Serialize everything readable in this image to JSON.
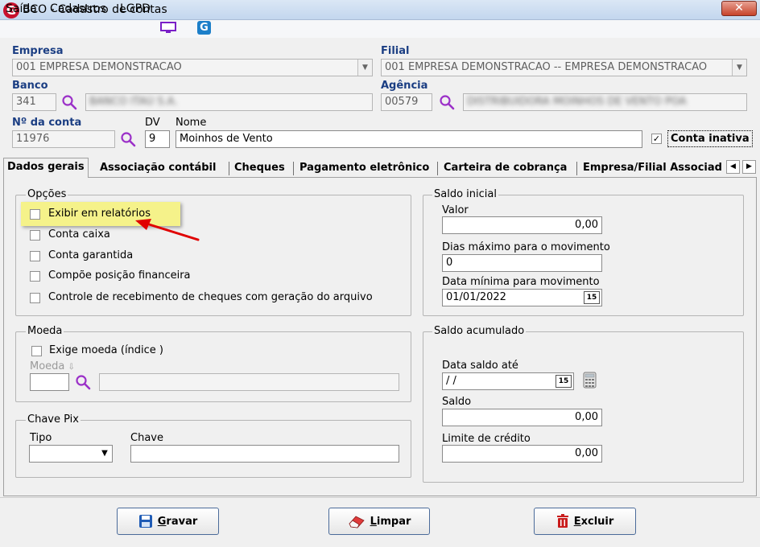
{
  "window": {
    "logo": "G",
    "title": "BCO - Cadastro de contas",
    "close": "✕"
  },
  "menu": {
    "items": [
      "Saída",
      "Cadastros",
      "LGPD"
    ],
    "g_logo": "G"
  },
  "colors": {
    "accent": "#1b3e83",
    "highlight": "#f5f28a",
    "arrow": "#e00000",
    "search": "#9b30c8"
  },
  "header": {
    "empresa_label": "Empresa",
    "empresa_value": "001 EMPRESA DEMONSTRACAO",
    "filial_label": "Filial",
    "filial_value": "001 EMPRESA DEMONSTRACAO -- EMPRESA DEMONSTRACAO",
    "banco_label": "Banco",
    "banco_code": "341",
    "banco_name": "BANCO ITAÚ S.A.",
    "agencia_label": "Agência",
    "agencia_code": "00579",
    "agencia_name": "DISTRIBUIDORA MOINHOS DE VENTO POA",
    "conta_label": "Nº da conta",
    "conta_value": "11976",
    "dv_label": "DV",
    "dv_value": "9",
    "nome_label": "Nome",
    "nome_value": "Moinhos de Vento",
    "inativa_label": "Conta inativa",
    "inativa_checked": true,
    "check_mark": "✓"
  },
  "tabs": [
    "Dados gerais",
    "Associação contábil",
    "Cheques",
    "Pagamento eletrônico",
    "Carteira de cobrança",
    "Empresa/Filial Associad"
  ],
  "tab_scroll": {
    "left": "◀",
    "right": "▶"
  },
  "opcoes": {
    "title": "Opções",
    "items": [
      "Exibir em relatórios",
      "Conta caixa",
      "Conta garantida",
      "Compõe posição financeira",
      "Controle de recebimento de cheques com geração do arquivo"
    ]
  },
  "moeda": {
    "title": "Moeda",
    "exige_label": "Exige moeda (índice )",
    "moeda_label": "Moeda",
    "moeda_suffix": "⇩"
  },
  "pix": {
    "title": "Chave Pix",
    "tipo_label": "Tipo",
    "chave_label": "Chave"
  },
  "saldo_inicial": {
    "title": "Saldo inicial",
    "valor_label": "Valor",
    "valor": "0,00",
    "dias_label": "Dias máximo para o movimento",
    "dias": "0",
    "data_label": "Data mínima para movimento",
    "data": "01/01/2022",
    "cal_text": "15"
  },
  "saldo_acumulado": {
    "title": "Saldo acumulado",
    "data_label": "Data saldo até",
    "data": " /  /",
    "saldo_label": "Saldo",
    "saldo": "0,00",
    "limite_label": "Limite de crédito",
    "limite": "0,00",
    "cal_text": "15"
  },
  "buttons": {
    "gravar_key": "G",
    "gravar_rest": "ravar",
    "limpar_key": "L",
    "limpar_rest": "impar",
    "excluir_key": "E",
    "excluir_rest": "xcluir"
  },
  "icons": {
    "search": "magnifier-icon",
    "calendar": "calendar-icon",
    "calculator": "calculator-icon",
    "save": "floppy-disk-icon",
    "clear": "eraser-icon",
    "delete": "trash-icon",
    "monitor": "monitor-icon"
  }
}
